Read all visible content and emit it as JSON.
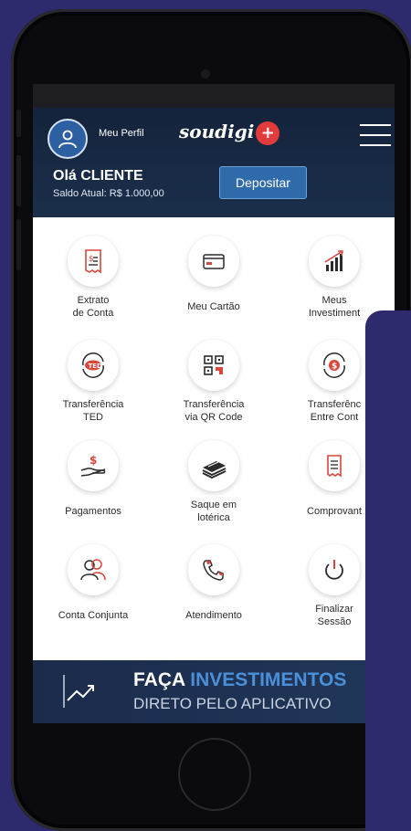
{
  "header": {
    "profile_label": "Meu Perfil",
    "brand_name": "soudigi",
    "brand_plus": "+",
    "greeting": "Olá CLIENTE",
    "balance": "Saldo Atual: R$ 1.000,00",
    "deposit_button": "Depositar"
  },
  "menu": {
    "items": [
      {
        "label": "Extrato\nde Conta",
        "icon": "statement-icon"
      },
      {
        "label": "Meu Cartão",
        "icon": "card-icon"
      },
      {
        "label": "Meus\nInvestiment",
        "icon": "investments-icon"
      },
      {
        "label": "Transferência\nTED",
        "icon": "ted-transfer-icon"
      },
      {
        "label": "Transferência\nvia QR Code",
        "icon": "qr-code-icon"
      },
      {
        "label": "Transferênc\nEntre Cont",
        "icon": "internal-transfer-icon"
      },
      {
        "label": "Pagamentos",
        "icon": "payments-icon"
      },
      {
        "label": "Saque em\nlotérica",
        "icon": "cash-withdrawal-icon"
      },
      {
        "label": "Comprovant",
        "icon": "receipt-icon"
      },
      {
        "label": "Conta Conjunta",
        "icon": "joint-account-icon"
      },
      {
        "label": "Atendimento",
        "icon": "phone-support-icon"
      },
      {
        "label": "Finalizar\nSessão",
        "icon": "power-icon"
      }
    ]
  },
  "banner": {
    "line1_prefix": "FAÇA ",
    "line1_highlight": "INVESTIMENTOS",
    "line2": "DIRETO PELO APLICATIVO"
  },
  "colors": {
    "background": "#2e2a6e",
    "header": "#1b2f4b",
    "accent_blue": "#2f6bab",
    "accent_red": "#e23b3b"
  }
}
